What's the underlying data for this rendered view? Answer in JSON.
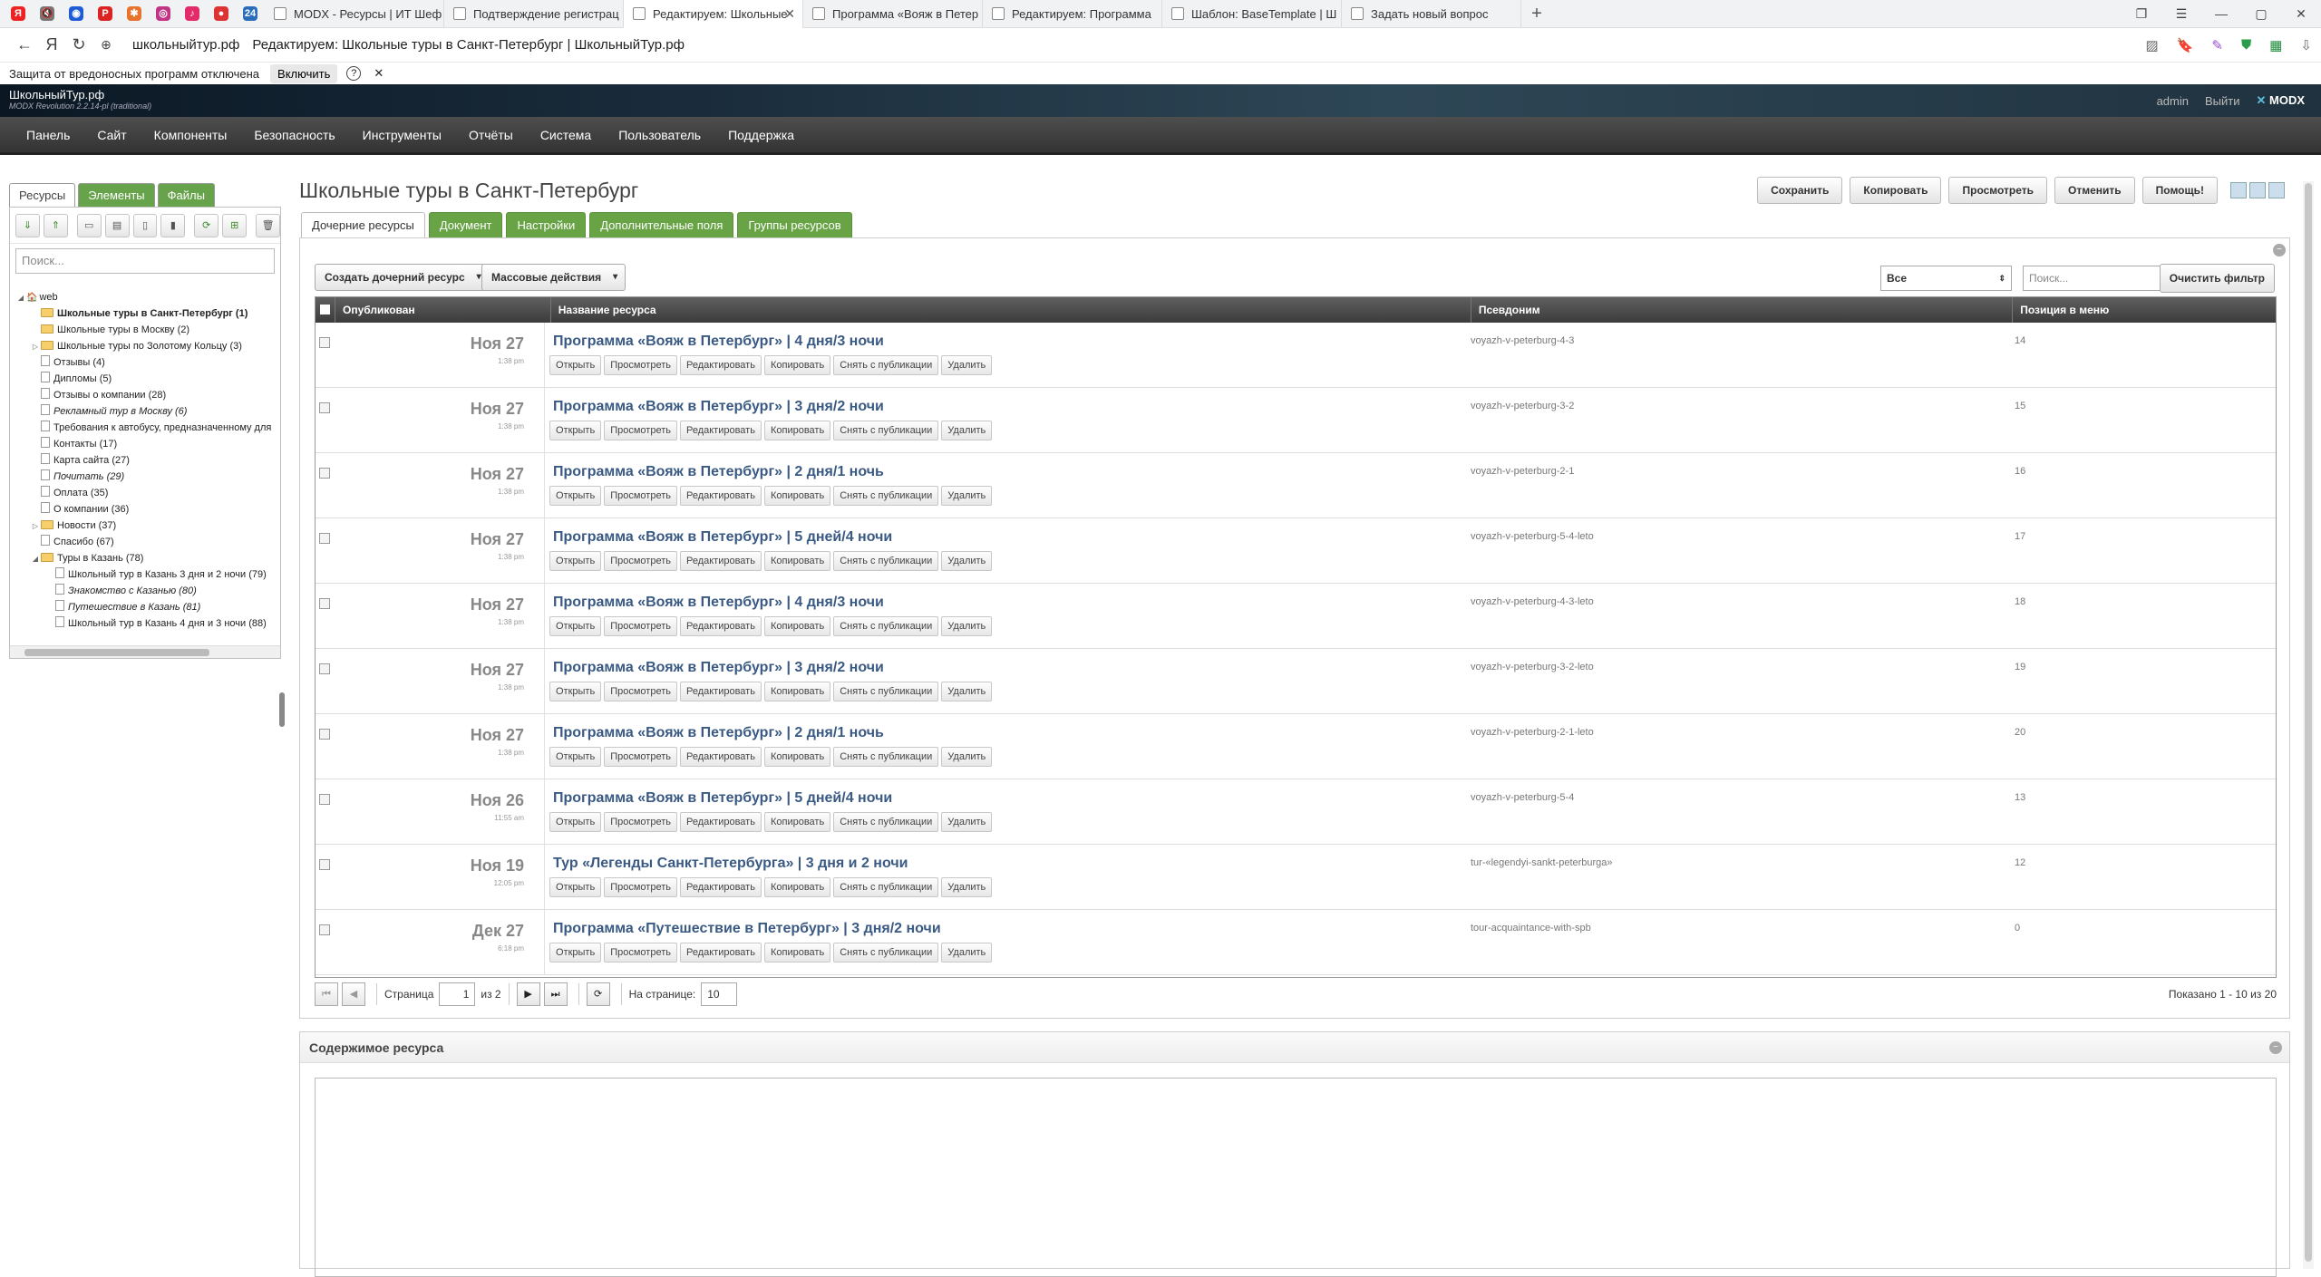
{
  "browser": {
    "pinned": [
      {
        "icon": "yandex-icon",
        "glyph": "Я",
        "color": "#e22"
      },
      {
        "icon": "mute-icon",
        "glyph": "🔇",
        "color": "#777"
      },
      {
        "icon": "vk-icon",
        "glyph": "◉",
        "color": "#1e5bd6"
      },
      {
        "icon": "pinterest-icon",
        "glyph": "P",
        "color": "#d22"
      },
      {
        "icon": "zen-icon",
        "glyph": "✱",
        "color": "#e8732c"
      },
      {
        "icon": "instagram-icon",
        "glyph": "◎",
        "color": "#c13584"
      },
      {
        "icon": "music-icon",
        "glyph": "♪",
        "color": "#e22b68"
      },
      {
        "icon": "tomato-icon",
        "glyph": "●",
        "color": "#d33"
      },
      {
        "icon": "bitrix-icon",
        "glyph": "24",
        "color": "#2a6ebb"
      }
    ],
    "tabs": [
      {
        "title": "MODX - Ресурсы | ИТ Шеф",
        "active": false
      },
      {
        "title": "Подтверждение регистрац",
        "active": false
      },
      {
        "title": "Редактируем: Школьные",
        "active": true
      },
      {
        "title": "Программа «Вояж в Петер",
        "active": false
      },
      {
        "title": "Редактируем: Программа",
        "active": false
      },
      {
        "title": "Шаблон: BaseTemplate | Ш",
        "active": false
      },
      {
        "title": "Задать новый вопрос",
        "active": false
      }
    ],
    "new_tab": "+",
    "url": "школьныйтур.рф",
    "page_title": "Редактируем: Школьные туры в Санкт-Петербург | ШкольныйТур.рф"
  },
  "infobar": {
    "text": "Защита от вредоносных программ отключена",
    "button": "Включить",
    "help": "?",
    "close": "✕"
  },
  "modx_header": {
    "site_name": "ШкольныйТур.рф",
    "version": "MODX Revolution 2.2.14-pl (traditional)",
    "user": "admin",
    "logout": "Выйти",
    "logo": "MODX"
  },
  "top_menu": [
    "Панель",
    "Сайт",
    "Компоненты",
    "Безопасность",
    "Инструменты",
    "Отчёты",
    "Система",
    "Пользователь",
    "Поддержка"
  ],
  "sidebar": {
    "tabs": [
      "Ресурсы",
      "Элементы",
      "Файлы"
    ],
    "search_placeholder": "Поиск...",
    "tree": [
      {
        "label": "web",
        "level": 0,
        "type": "root",
        "arrow": "◢"
      },
      {
        "label": "Школьные туры в Санкт-Петербург  (1)",
        "level": 1,
        "type": "folder",
        "bold": true
      },
      {
        "label": "Школьные туры в Москву  (2)",
        "level": 1,
        "type": "folder"
      },
      {
        "label": "Школьные туры по Золотому Кольцу  (3)",
        "level": 1,
        "type": "folder",
        "arrow": "▷"
      },
      {
        "label": "Отзывы  (4)",
        "level": 1,
        "type": "page"
      },
      {
        "label": "Дипломы  (5)",
        "level": 1,
        "type": "page"
      },
      {
        "label": "Отзывы о компании  (28)",
        "level": 1,
        "type": "page"
      },
      {
        "label": "Рекламный тур в Москву  (6)",
        "level": 1,
        "type": "page",
        "italic": true
      },
      {
        "label": "Требования к автобусу, предназначенному для",
        "level": 1,
        "type": "page"
      },
      {
        "label": "Контакты  (17)",
        "level": 1,
        "type": "page"
      },
      {
        "label": "Карта сайта  (27)",
        "level": 1,
        "type": "page"
      },
      {
        "label": "Почитать  (29)",
        "level": 1,
        "type": "page",
        "italic": true
      },
      {
        "label": "Оплата  (35)",
        "level": 1,
        "type": "page"
      },
      {
        "label": "О компании  (36)",
        "level": 1,
        "type": "page"
      },
      {
        "label": "Новости  (37)",
        "level": 1,
        "type": "folder",
        "arrow": "▷"
      },
      {
        "label": "Спасибо  (67)",
        "level": 1,
        "type": "page"
      },
      {
        "label": "Туры в Казань  (78)",
        "level": 1,
        "type": "folder",
        "arrow": "◢"
      },
      {
        "label": "Школьный тур в Казань 3 дня и 2 ночи  (79)",
        "level": 2,
        "type": "page"
      },
      {
        "label": "Знакомство с Казанью  (80)",
        "level": 2,
        "type": "page",
        "italic": true
      },
      {
        "label": "Путешествие в Казань  (81)",
        "level": 2,
        "type": "page",
        "italic": true
      },
      {
        "label": "Школьный тур в Казань 4 дня и 3 ночи  (88)",
        "level": 2,
        "type": "page"
      }
    ]
  },
  "main": {
    "title": "Школьные туры в Санкт-Петербург",
    "actions": [
      "Сохранить",
      "Копировать",
      "Просмотреть",
      "Отменить",
      "Помощь!"
    ],
    "doc_tabs": [
      "Дочерние ресурсы",
      "Документ",
      "Настройки",
      "Дополнительные поля",
      "Группы ресурсов"
    ],
    "create_child": "Создать дочерний ресурс",
    "bulk_actions": "Массовые действия",
    "filter_value": "Все",
    "filter_placeholder": "Поиск...",
    "clear_filter": "Очистить фильтр",
    "columns": [
      "Опубликован",
      "Название ресурса",
      "Псевдоним",
      "Позиция в меню"
    ],
    "row_actions": [
      "Открыть",
      "Просмотреть",
      "Редактировать",
      "Копировать",
      "Снять с публикации",
      "Удалить"
    ],
    "rows": [
      {
        "date": "Ноя 27",
        "time": "1:38 pm",
        "name": "Программа «Вояж в Петербург» | 4 дня/3 ночи",
        "alias": "voyazh-v-peterburg-4-3",
        "pos": "14"
      },
      {
        "date": "Ноя 27",
        "time": "1:38 pm",
        "name": "Программа «Вояж в Петербург» | 3 дня/2 ночи",
        "alias": "voyazh-v-peterburg-3-2",
        "pos": "15"
      },
      {
        "date": "Ноя 27",
        "time": "1:38 pm",
        "name": "Программа «Вояж в Петербург» | 2 дня/1 ночь",
        "alias": "voyazh-v-peterburg-2-1",
        "pos": "16"
      },
      {
        "date": "Ноя 27",
        "time": "1:38 pm",
        "name": "Программа «Вояж в Петербург» | 5 дней/4 ночи",
        "alias": "voyazh-v-peterburg-5-4-leto",
        "pos": "17"
      },
      {
        "date": "Ноя 27",
        "time": "1:38 pm",
        "name": "Программа «Вояж в Петербург» | 4 дня/3 ночи",
        "alias": "voyazh-v-peterburg-4-3-leto",
        "pos": "18"
      },
      {
        "date": "Ноя 27",
        "time": "1:38 pm",
        "name": "Программа «Вояж в Петербург» | 3 дня/2 ночи",
        "alias": "voyazh-v-peterburg-3-2-leto",
        "pos": "19"
      },
      {
        "date": "Ноя 27",
        "time": "1:38 pm",
        "name": "Программа «Вояж в Петербург» | 2 дня/1 ночь",
        "alias": "voyazh-v-peterburg-2-1-leto",
        "pos": "20"
      },
      {
        "date": "Ноя 26",
        "time": "11:55 am",
        "name": "Программа «Вояж в Петербург» | 5 дней/4 ночи",
        "alias": "voyazh-v-peterburg-5-4",
        "pos": "13"
      },
      {
        "date": "Ноя 19",
        "time": "12:05 pm",
        "name": "Тур «Легенды Санкт-Петербурга» | 3 дня и 2 ночи",
        "alias": "tur-«legendyi-sankt-peterburga»",
        "pos": "12"
      },
      {
        "date": "Дек 27",
        "time": "6:18 pm",
        "name": "Программа «Путешествие в Петербург» | 3 дня/2 ночи",
        "alias": "tour-acquaintance-with-spb",
        "pos": "0"
      }
    ],
    "pager": {
      "page_label": "Страница",
      "page_value": "1",
      "of_label": "из 2",
      "per_page_label": "На странице:",
      "per_page_value": "10",
      "info": "Показано 1 - 10 из 20"
    },
    "content_panel_title": "Содержимое ресурса"
  }
}
